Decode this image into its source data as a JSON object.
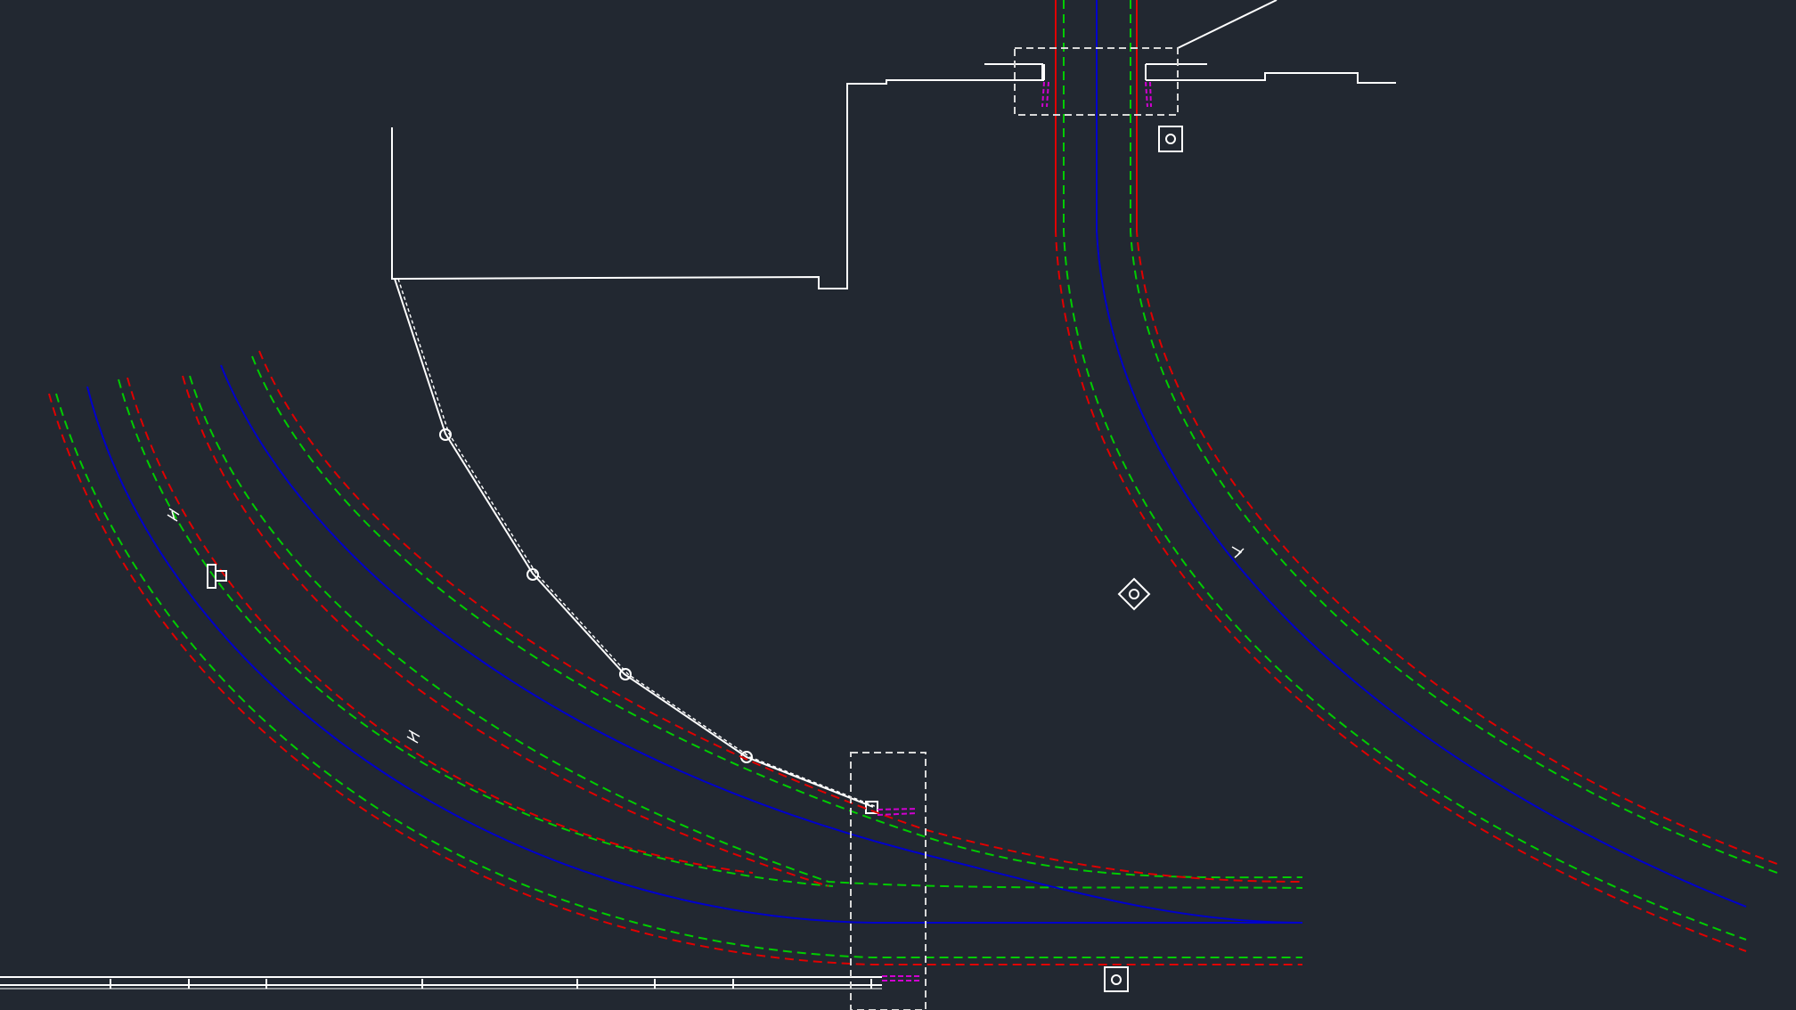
{
  "app": {
    "type": "cad-drawing-canvas"
  },
  "colors": {
    "background": "#222831",
    "track_outer_red": "#e00000",
    "track_inner_green": "#00cc00",
    "track_centerline_blue": "#0000cc",
    "geometry_white": "#ffffff",
    "detail_magenta": "#d000d0",
    "dashed_box": "#d8d8d8"
  },
  "icons": {
    "signal_post": "signal-post-icon",
    "square_marker": "square-marker-icon",
    "diamond_marker": "diamond-marker-icon",
    "small_label_glyph": "text-glyph-icon"
  }
}
